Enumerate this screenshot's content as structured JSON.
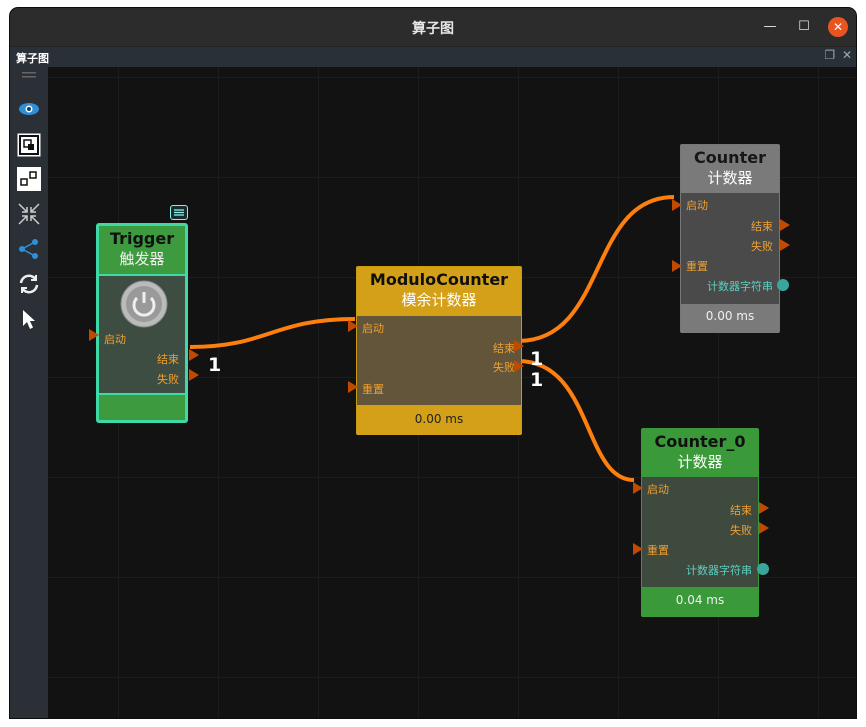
{
  "window": {
    "title": "算子图"
  },
  "dock": {
    "title": "算子图"
  },
  "nodes": {
    "trigger": {
      "name": "Trigger",
      "subtitle": "触发器",
      "in_start": "启动",
      "out_end": "结束",
      "out_fail": "失败"
    },
    "modulo": {
      "name": "ModuloCounter",
      "subtitle": "模余计数器",
      "in_start": "启动",
      "in_reset": "重置",
      "out_end": "结束",
      "out_fail": "失败",
      "time": "0.00 ms"
    },
    "counter": {
      "name": "Counter",
      "subtitle": "计数器",
      "in_start": "启动",
      "in_reset": "重置",
      "out_end": "结束",
      "out_fail": "失败",
      "out_str": "计数器字符串",
      "time": "0.00 ms"
    },
    "counter0": {
      "name": "Counter_0",
      "subtitle": "计数器",
      "in_start": "启动",
      "in_reset": "重置",
      "out_end": "结束",
      "out_fail": "失败",
      "out_str": "计数器字符串",
      "time": "0.04 ms"
    }
  },
  "edge_labels": {
    "trigger_out": "1",
    "modulo_end": "1",
    "modulo_fail": "1"
  },
  "colors": {
    "trigger": "#3fd9a8",
    "modulo": "#d4a017",
    "counter": "#7a7a7a",
    "counter0": "#3a9a3a",
    "edge": "#ff7f0e"
  },
  "icons": [
    "eye-icon",
    "fit-view-icon",
    "layout-icon",
    "collapse-icon",
    "share-graph-icon",
    "refresh-icon",
    "pointer-icon",
    "power-icon",
    "comment-icon"
  ]
}
